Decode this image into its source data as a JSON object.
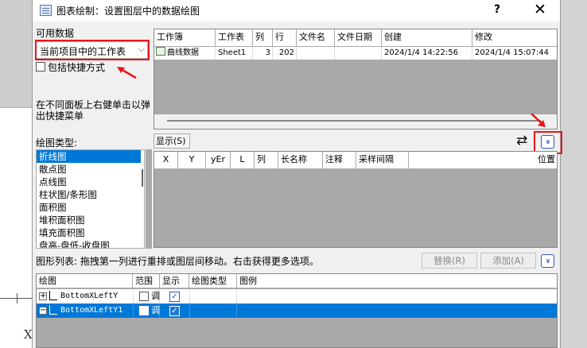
{
  "background": {
    "axis_label": "X"
  },
  "dialog": {
    "title": "图表绘制：设置图层中的数据绘图",
    "help": "?",
    "close": "✕"
  },
  "available": {
    "label": "可用数据",
    "selected": "当前项目中的工作表",
    "include_shortcuts": "包括快捷方式",
    "hint": "在不同面板上右健单击以弹出快捷菜单"
  },
  "workbook_table": {
    "columns": [
      "工作簿",
      "工作表",
      "列",
      "行",
      "文件名",
      "文件日期",
      "创建",
      "修改"
    ],
    "rows": [
      {
        "workbook": "曲线数据",
        "sheet": "Sheet1",
        "cols": "3",
        "rows": "202",
        "filename": "",
        "filedate": "",
        "created": "2024/1/4 14:22:56",
        "modified": "2024/1/4 15:07:44"
      }
    ]
  },
  "show_button": "显示(S)",
  "swap_icon": "⇄",
  "expand_icon": "»",
  "plot_types": {
    "label": "绘图类型:",
    "items": [
      "折线图",
      "散点图",
      "点线图",
      "柱状图/条形图",
      "面积图",
      "堆积面积图",
      "填充面积图",
      "盘高-盘低-收盘图"
    ]
  },
  "selection_table": {
    "columns": [
      "X",
      "Y",
      "yEr",
      "L",
      "列",
      "长名称",
      "注释",
      "采样间隔",
      "位置"
    ]
  },
  "plot_list": {
    "label": "图形列表: 拖拽第一列进行重排或图层间移动。右击获得更多选项。",
    "replace": "替换(R)",
    "add": "添加(A)",
    "columns": [
      "绘图",
      "范围",
      "显示",
      "绘图类型",
      "图例"
    ],
    "rows": [
      {
        "name": "BottomXLeftY",
        "range": "调",
        "shown": "✓"
      },
      {
        "name": "BottomXLeftY1",
        "range": "调",
        "shown": "✓"
      }
    ]
  },
  "accent_colors": {
    "selection": "#0078d7",
    "annotation": "#e8141b",
    "expand_button": "#1f3fd0"
  }
}
